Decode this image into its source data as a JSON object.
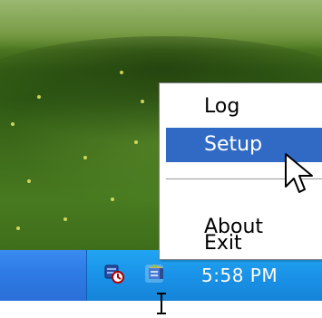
{
  "menu": {
    "items": [
      {
        "label": "Log",
        "highlighted": false
      },
      {
        "label": "Setup",
        "highlighted": true
      },
      {
        "label": "About",
        "highlighted": false
      },
      {
        "label": "Exit",
        "highlighted": false
      }
    ]
  },
  "taskbar": {
    "clock": "5:58 PM",
    "tray_icons": [
      "monitor-clock-icon",
      "colorful-cube-app-icon"
    ]
  },
  "colors": {
    "highlight": "#316ac5",
    "taskbar": "#2f7ce6",
    "tray": "#1a93e8"
  }
}
